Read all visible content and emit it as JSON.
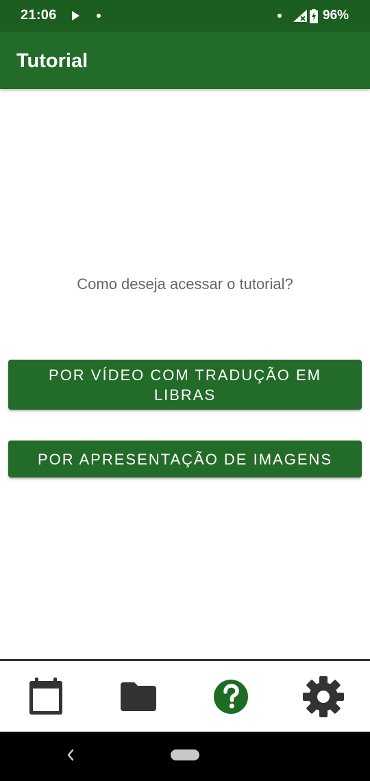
{
  "status_bar": {
    "time": "21:06",
    "battery": "96%",
    "icons": [
      "play-icon",
      "notification-dot-icon",
      "signal-icon",
      "battery-charging-icon"
    ]
  },
  "app_bar": {
    "title": "Tutorial"
  },
  "main": {
    "prompt": "Como deseja acessar o tutorial?",
    "buttons": [
      {
        "label": "POR VÍDEO COM TRADUÇÃO EM LIBRAS"
      },
      {
        "label": "POR APRESENTAÇÃO DE IMAGENS"
      }
    ]
  },
  "bottom_nav": {
    "items": [
      {
        "icon": "calendar-icon"
      },
      {
        "icon": "folder-icon"
      },
      {
        "icon": "help-icon",
        "active": true
      },
      {
        "icon": "gear-icon"
      }
    ]
  },
  "colors": {
    "status_bar": "#1b5e20",
    "primary": "#236b28",
    "nav_icon": "#333333",
    "active_icon": "#1e6b22",
    "prompt_text": "#666666"
  }
}
